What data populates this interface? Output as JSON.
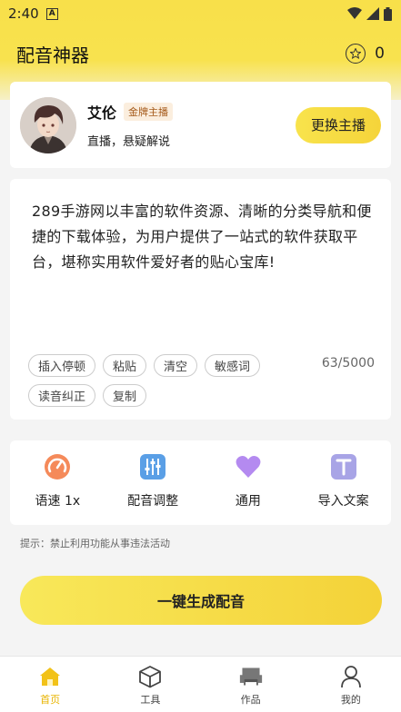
{
  "status_bar": {
    "time": "2:40",
    "a_badge": "A"
  },
  "app_bar": {
    "title": "配音神器",
    "coins": "0"
  },
  "anchor": {
    "name": "艾伦",
    "badge": "金牌主播",
    "description": "直播，悬疑解说",
    "change_label": "更换主播"
  },
  "editor": {
    "text": "289手游网以丰富的软件资源、清晰的分类导航和便捷的下载体验，为用户提供了一站式的软件获取平台，堪称实用软件爱好者的贴心宝库!",
    "counter": "63/5000",
    "chips": [
      "插入停顿",
      "粘贴",
      "清空",
      "敏感词",
      "读音纠正",
      "复制"
    ]
  },
  "tools": [
    {
      "label": "语速 1x",
      "icon": "speed-gauge-icon",
      "color": "#f58a5a"
    },
    {
      "label": "配音调整",
      "icon": "equalizer-icon",
      "color": "#5a9fe6"
    },
    {
      "label": "通用",
      "icon": "heart-icon",
      "color": "#b48af0"
    },
    {
      "label": "导入文案",
      "icon": "text-import-icon",
      "color": "#a8a4e6"
    }
  ],
  "hint": "提示：禁止利用功能从事违法活动",
  "generate_label": "一键生成配音",
  "bottom_nav": [
    {
      "label": "首页",
      "icon": "home-icon",
      "active": true
    },
    {
      "label": "工具",
      "icon": "cube-icon",
      "active": false
    },
    {
      "label": "作品",
      "icon": "works-icon",
      "active": false
    },
    {
      "label": "我的",
      "icon": "user-icon",
      "active": false
    }
  ],
  "colors": {
    "accent": "#f8e04a",
    "active_nav": "#e8b400"
  }
}
